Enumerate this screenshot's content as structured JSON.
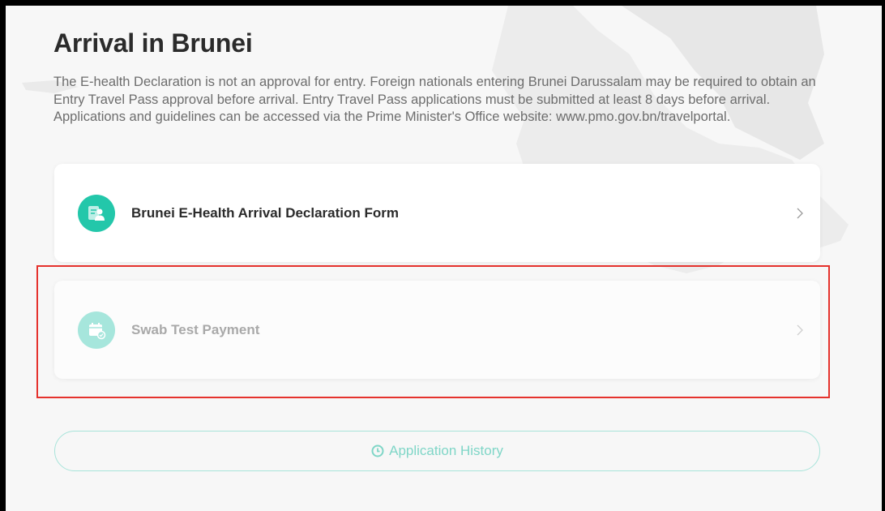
{
  "page": {
    "title": "Arrival in Brunei",
    "intro": "The E-health Declaration is not an approval for entry. Foreign nationals entering Brunei Darussalam may be required to obtain an Entry Travel Pass approval before arrival. Entry Travel Pass applications must be submitted at least 8 days before arrival. Applications and guidelines can be accessed via the Prime Minister's Office website: www.pmo.gov.bn/travelportal."
  },
  "cards": [
    {
      "label": "Brunei E-Health Arrival Declaration Form",
      "icon": "health-form-icon",
      "enabled": true
    },
    {
      "label": "Swab Test Payment",
      "icon": "payment-calendar-icon",
      "enabled": false
    }
  ],
  "history_button": {
    "label": "Application History",
    "icon": "clock-icon"
  },
  "colors": {
    "accent": "#23c7aa",
    "accent_light": "#a6e6dc",
    "highlight_border": "#e5322d",
    "text_dark": "#2b2b2b",
    "text_muted": "#6d6d6d"
  }
}
